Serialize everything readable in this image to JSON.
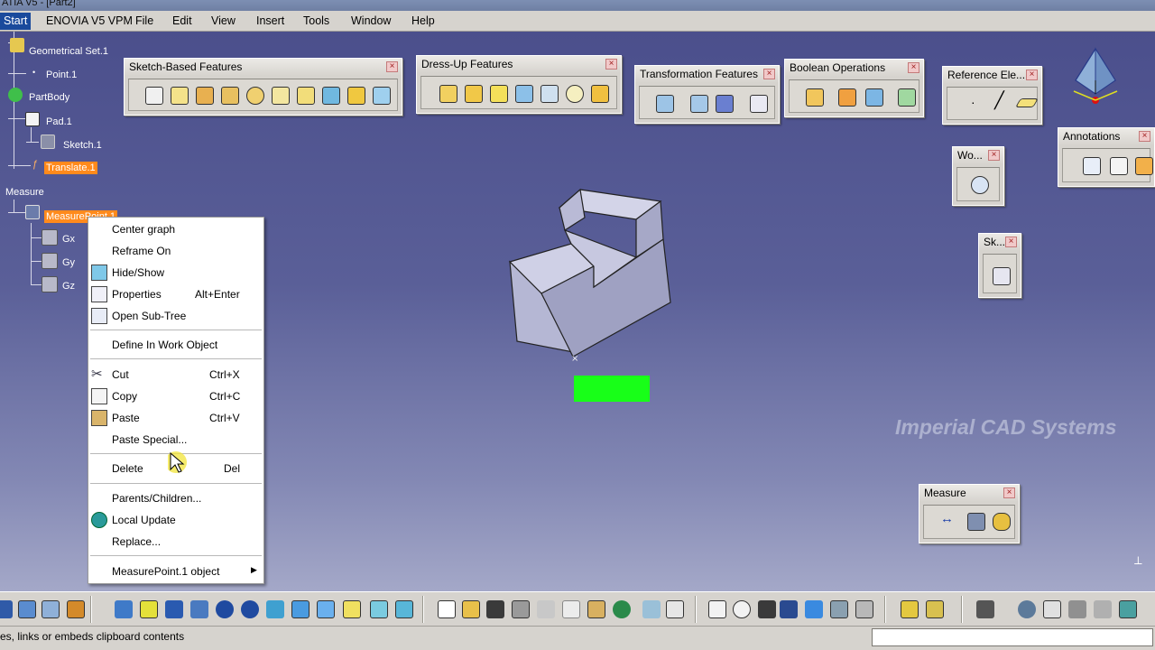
{
  "window": {
    "title": "ATIA V5 - [Part2]"
  },
  "menubar": {
    "start": "Start",
    "items": [
      "ENOVIA V5 VPM",
      "File",
      "Edit",
      "View",
      "Insert",
      "Tools",
      "Window",
      "Help"
    ]
  },
  "tree": {
    "geometrical_set": "Geometrical Set.1",
    "point": "Point.1",
    "partbody": "PartBody",
    "pad": "Pad.1",
    "sketch": "Sketch.1",
    "translate": "Translate.1",
    "measure": "Measure",
    "measurepoint": "MeasurePoint.1",
    "gx": "Gx",
    "gy": "Gy",
    "gz": "Gz"
  },
  "toolbars": {
    "sketch_based": "Sketch-Based Features",
    "dress_up": "Dress-Up Features",
    "transformation": "Transformation Features",
    "boolean": "Boolean Operations",
    "reference": "Reference Ele...",
    "annotations": "Annotations",
    "wo": "Wo...",
    "sk": "Sk...",
    "measure": "Measure"
  },
  "context_menu": {
    "items": [
      {
        "label": "Center graph",
        "shortcut": ""
      },
      {
        "label": "Reframe On",
        "shortcut": ""
      },
      {
        "label": "Hide/Show",
        "shortcut": ""
      },
      {
        "label": "Properties",
        "shortcut": "Alt+Enter"
      },
      {
        "label": "Open Sub-Tree",
        "shortcut": ""
      },
      {
        "label": "Define In Work Object",
        "shortcut": ""
      },
      {
        "label": "Cut",
        "shortcut": "Ctrl+X"
      },
      {
        "label": "Copy",
        "shortcut": "Ctrl+C"
      },
      {
        "label": "Paste",
        "shortcut": "Ctrl+V"
      },
      {
        "label": "Paste Special...",
        "shortcut": ""
      },
      {
        "label": "Delete",
        "shortcut": "Del"
      },
      {
        "label": "Parents/Children...",
        "shortcut": ""
      },
      {
        "label": "Local Update",
        "shortcut": ""
      },
      {
        "label": "Replace...",
        "shortcut": ""
      },
      {
        "label": "MeasurePoint.1 object",
        "shortcut": ""
      }
    ]
  },
  "watermark": "Imperial CAD Systems",
  "status": {
    "message": "es, links or embeds clipboard contents",
    "command_input": ""
  },
  "colors": {
    "highlight": "#ff8a1c",
    "viewport_top": "#4b4f8c",
    "selection_green": "#18ff18",
    "part_face": "#b9bad6"
  }
}
